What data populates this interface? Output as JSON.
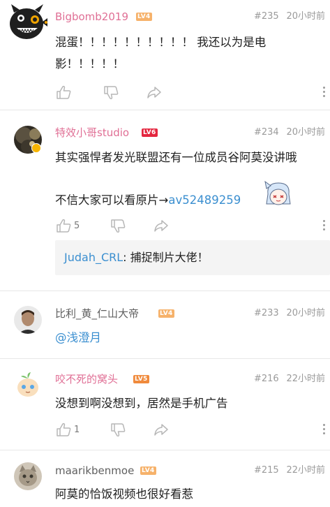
{
  "comments": [
    {
      "username": "Bigbomb2019",
      "level": "LV4",
      "floor": "#235",
      "time": "20小时前",
      "text": "混蛋！！！！！！！！！！ 我还以为是电影！！！！！"
    },
    {
      "username": "特效小哥studio",
      "level": "LV6",
      "floor": "#234",
      "time": "20小时前",
      "text_line1": "其实强悍者发光联盟还有一位成员谷阿莫没讲哦",
      "text_line2": "不信大家可以看原片→",
      "link": "av52489259",
      "like_count": "5",
      "reply_user": "Judah_CRL",
      "reply_text": ": 捕捉制片大佬！"
    },
    {
      "username": "比利_黄_仁山大帝",
      "level": "LV4",
      "floor": "#233",
      "time": "20小时前",
      "mention": "@浅澄月"
    },
    {
      "username": "咬不死的窝头",
      "level": "LV5",
      "floor": "#216",
      "time": "22小时前",
      "text": "没想到啊没想到，居然是手机广告",
      "like_count": "1"
    },
    {
      "username": "maarikbenmoe",
      "level": "LV4",
      "floor": "#215",
      "time": "22小时前",
      "text": "阿莫的恰饭视频也很好看惹"
    }
  ],
  "icons": {
    "like": "thumbs-up-icon",
    "dislike": "thumbs-down-icon",
    "share": "share-icon",
    "more": "more-vertical-icon"
  },
  "colors": {
    "vip_name": "#e06f95",
    "normal_name": "#5f5f5f",
    "link": "#3b8fd0",
    "lv4": "#f6b26b",
    "lv5": "#f08a3c",
    "lv6": "#e4263f"
  }
}
